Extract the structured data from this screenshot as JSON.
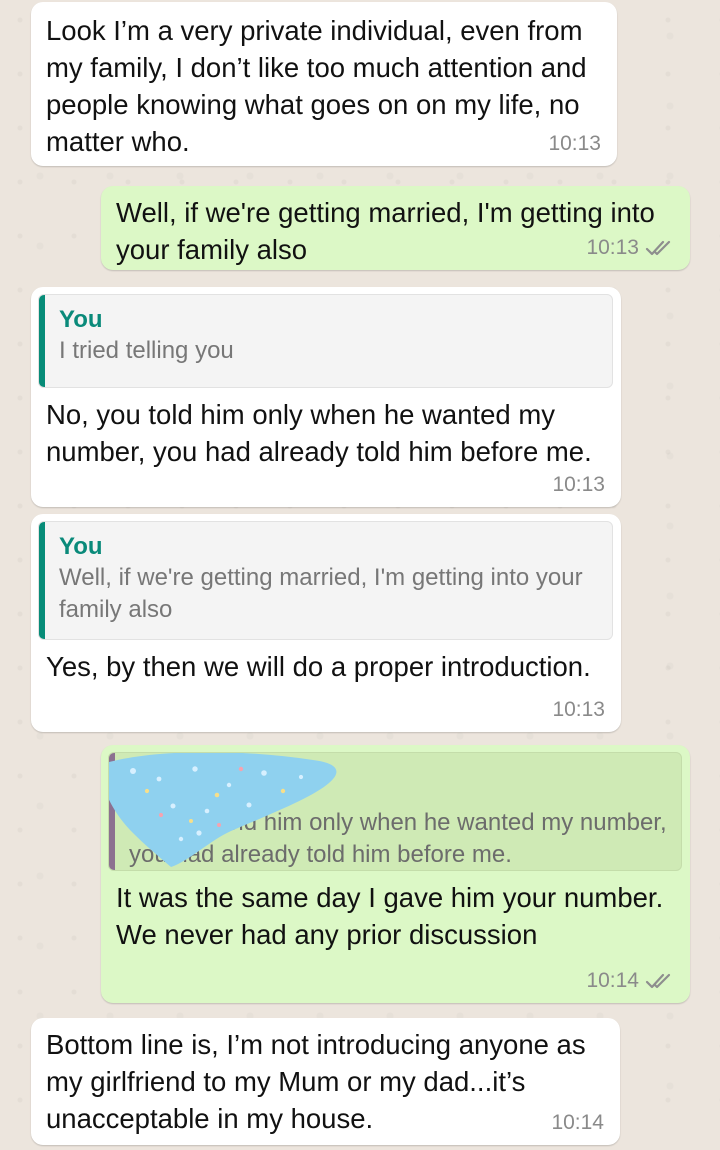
{
  "colors": {
    "incoming_bg": "#ffffff",
    "outgoing_bg": "#dcf8c6",
    "quote_accent_incoming": "#078c78",
    "quote_accent_outgoing": "#8c7190",
    "quote_sender": "#0a8a7a",
    "timestamp": "#8a8a8a",
    "scribble": "#8fd1ef"
  },
  "messages": [
    {
      "direction": "incoming",
      "text": "Look I’m a very private individual, even from my family, I don’t like too much attention and people knowing what goes on on my life, no matter who.",
      "time": "10:13"
    },
    {
      "direction": "outgoing",
      "text": "Well, if we're getting married, I'm getting into your family also",
      "time": "10:13",
      "status_icon": "double-check-icon"
    },
    {
      "direction": "incoming",
      "reply": {
        "sender": "You",
        "text": "I tried telling you"
      },
      "text": "No, you told him only when he wanted my number, you had already told him before me.",
      "time": "10:13"
    },
    {
      "direction": "incoming",
      "reply": {
        "sender": "You",
        "text": "Well, if we're getting married, I'm getting into your family also"
      },
      "text": "Yes, by then we will do a proper introduction.",
      "time": "10:13"
    },
    {
      "direction": "outgoing",
      "reply": {
        "text": "No, you told him only when he wanted my number, you had already told him before me."
      },
      "text": "It was the same day I gave him your number. We never had any prior discussion",
      "time": "10:14",
      "status_icon": "double-check-icon"
    },
    {
      "direction": "incoming",
      "text": "Bottom line is, I’m not introducing anyone as my girlfriend to my Mum or my dad...it’s unacceptable in my house.",
      "time": "10:14"
    }
  ]
}
